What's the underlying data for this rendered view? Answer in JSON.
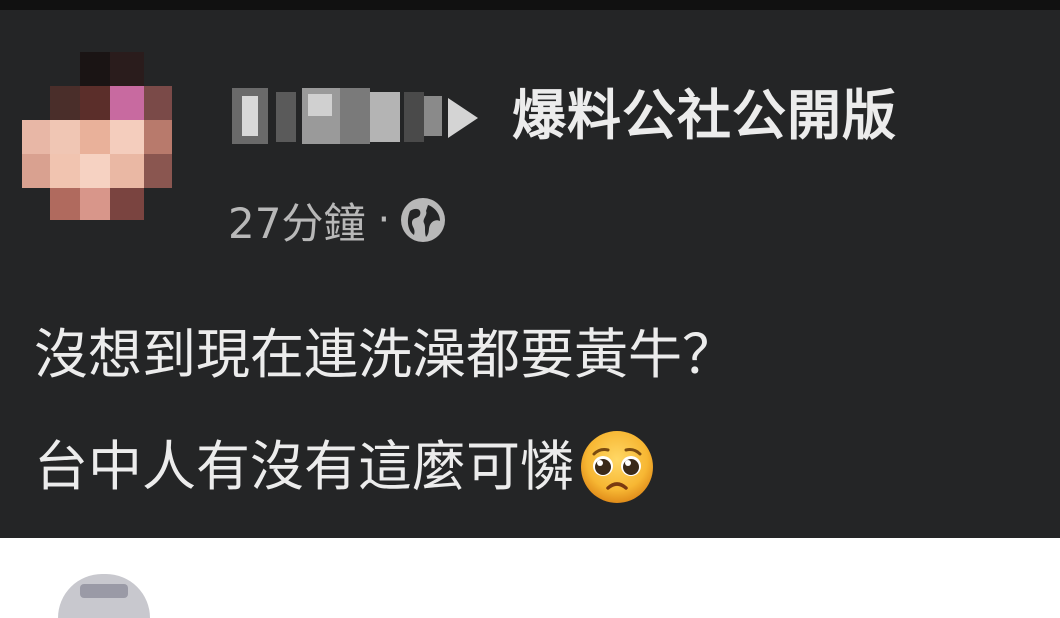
{
  "post": {
    "group_name": "爆料公社公開版",
    "time": "27分鐘",
    "separator": "·",
    "visibility_icon": "globe-icon",
    "text_line1": "沒想到現在連洗澡都要黃牛？",
    "text_line2": "台中人有沒有這麼可憐",
    "emoji": "pleading-face-emoji"
  },
  "colors": {
    "card_bg": "#242526",
    "text": "#ececec",
    "meta_text": "#b8b8b8"
  }
}
